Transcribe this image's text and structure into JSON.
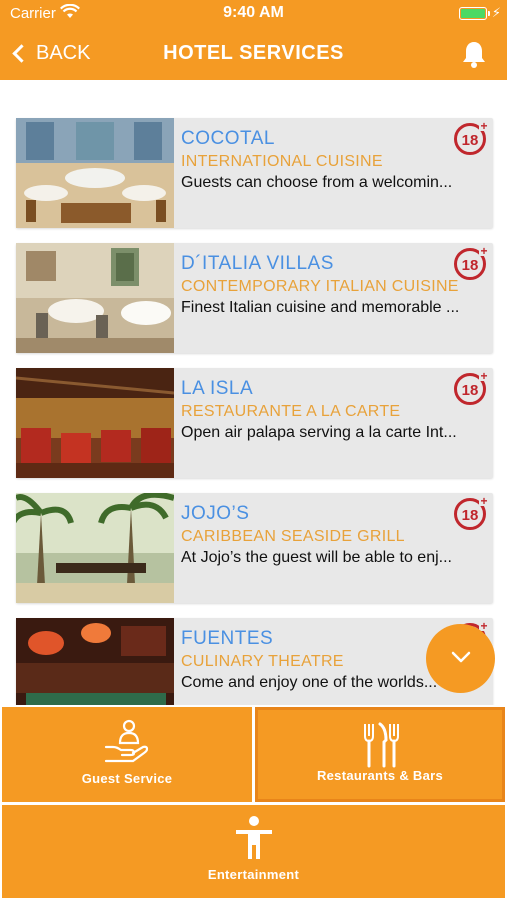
{
  "status_bar": {
    "carrier": "Carrier",
    "time": "9:40 AM",
    "battery_color": "#4cd964"
  },
  "header": {
    "back_label": "BACK",
    "title": "HOTEL SERVICES",
    "bell_icon": "bell-icon",
    "background": "#f59a23"
  },
  "restaurants": [
    {
      "name": "COCOTAL",
      "cuisine": "INTERNATIONAL CUISINE",
      "description": "Guests can choose from a welcomin...",
      "badge": "18+"
    },
    {
      "name": "D´ITALIA VILLAS",
      "cuisine": "CONTEMPORARY ITALIAN CUISINE",
      "description": "Finest Italian cuisine and memorable ...",
      "badge": "18+"
    },
    {
      "name": "LA ISLA",
      "cuisine": "RESTAURANTE A LA CARTE",
      "description": "Open air palapa serving a la carte Int...",
      "badge": "18+"
    },
    {
      "name": "JOJO’S",
      "cuisine": "CARIBBEAN SEASIDE GRILL",
      "description": "At Jojo’s the guest will be able to enj...",
      "badge": "18+"
    },
    {
      "name": "FUENTES",
      "cuisine": "CULINARY THEATRE",
      "description": "Come and enjoy one of the worlds...",
      "badge": "18+"
    }
  ],
  "fab": {
    "icon": "chevron-down-icon"
  },
  "tabs": [
    {
      "label": "Guest Service",
      "icon": "hand-person-icon"
    },
    {
      "label": "Restaurants & Bars",
      "icon": "cutlery-icon"
    },
    {
      "label": "Entertainment",
      "icon": "person-icon"
    }
  ],
  "colors": {
    "accent": "#f59a23",
    "name_blue": "#4a90e2",
    "cuisine_gold": "#e8a23a",
    "badge_red": "#c0272d"
  }
}
